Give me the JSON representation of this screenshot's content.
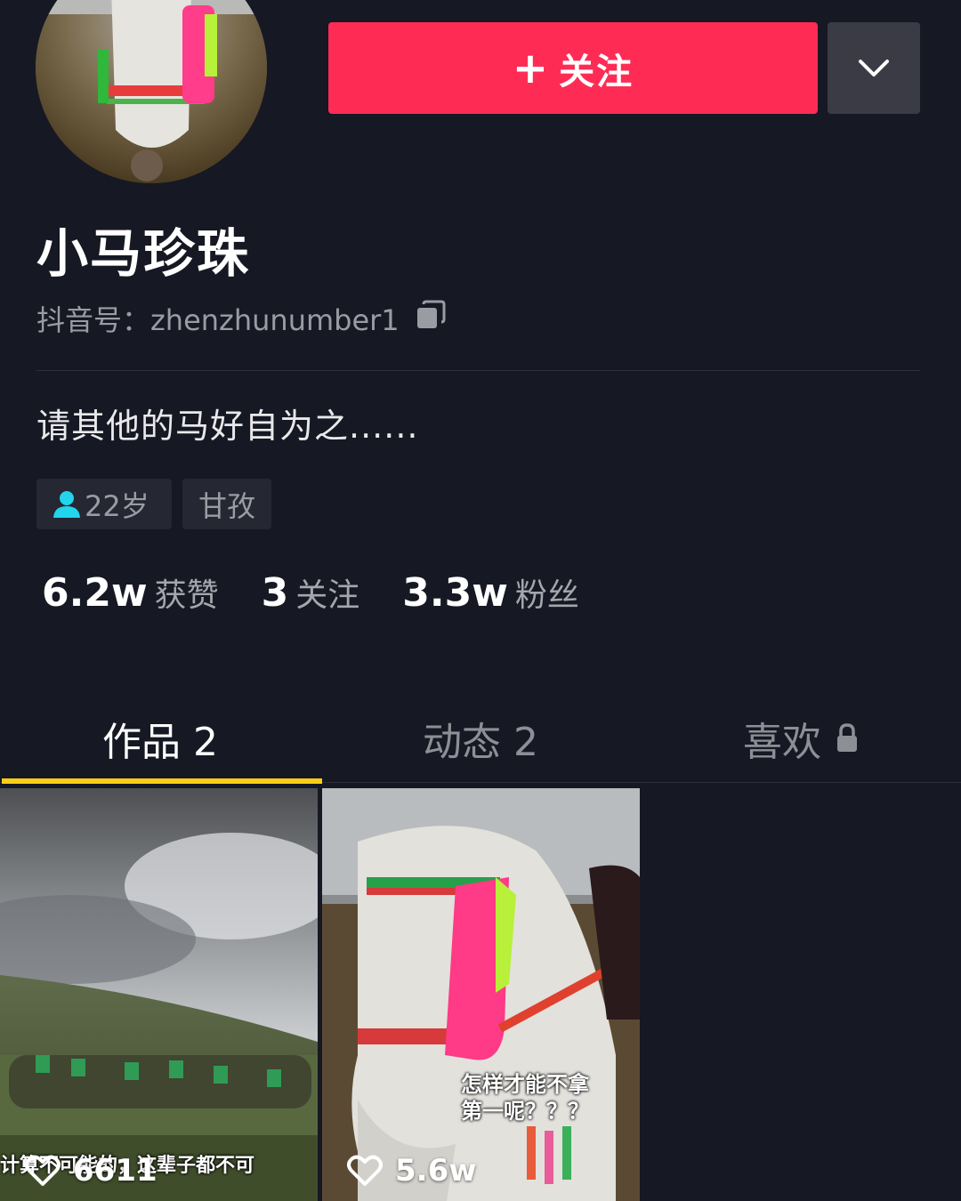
{
  "profile": {
    "follow_label": "关注",
    "username": "小马珍珠",
    "douyin_id": "抖音号：zhenzhunumber1",
    "bio": "请其他的马好自为之......",
    "tags": {
      "age": "22岁",
      "location": "甘孜"
    }
  },
  "stats": [
    {
      "value": "6.2w",
      "label": "获赞"
    },
    {
      "value": "3",
      "label": "关注"
    },
    {
      "value": "3.3w",
      "label": "粉丝"
    }
  ],
  "tabs": [
    {
      "label": "作品 2",
      "active": true
    },
    {
      "label": "动态 2",
      "active": false
    },
    {
      "label": "喜欢",
      "active": false,
      "icon": "lock-icon"
    }
  ],
  "videos": [
    {
      "likes": "6611",
      "caption": "计算不可能的，这辈子都不可"
    },
    {
      "likes": "5.6w",
      "caption_line1": "怎样才能不拿",
      "caption_line2": "第一呢？？？"
    }
  ],
  "colors": {
    "accent": "#fe2c55",
    "tab_indicator": "#face15",
    "background": "#161823"
  }
}
